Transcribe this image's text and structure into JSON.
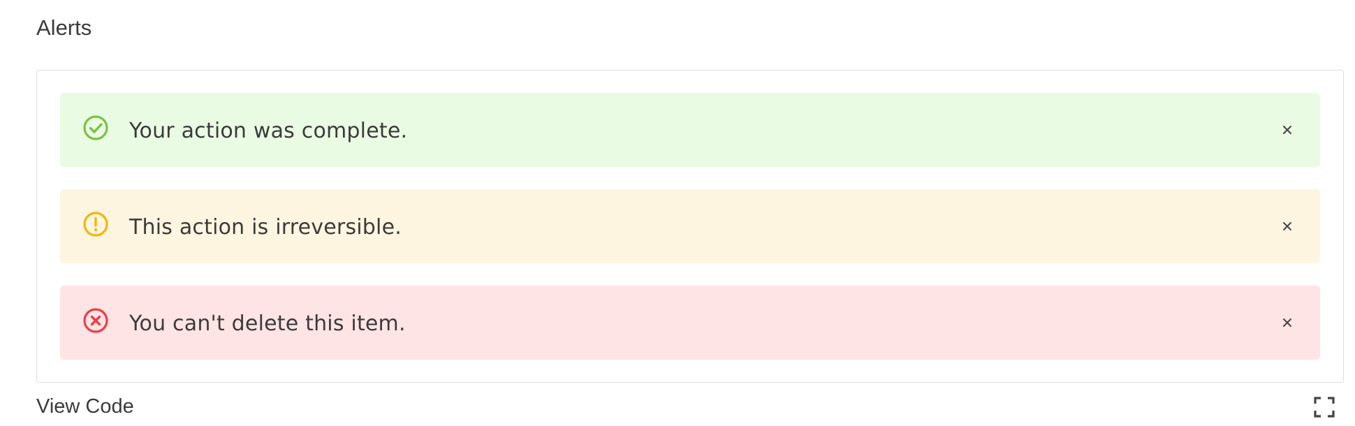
{
  "section": {
    "title": "Alerts"
  },
  "alerts": [
    {
      "type": "success",
      "message": "Your action was complete.",
      "icon": "check-circle-icon",
      "background": "#eafbe3",
      "icon_color": "#7cc143"
    },
    {
      "type": "warning",
      "message": "This action is irreversible.",
      "icon": "exclamation-circle-icon",
      "background": "#fdf5df",
      "icon_color": "#f5b50a"
    },
    {
      "type": "error",
      "message": "You can't delete this item.",
      "icon": "x-circle-icon",
      "background": "#fee4e5",
      "icon_color": "#ee3d48"
    }
  ],
  "footer": {
    "view_code_label": "View Code",
    "fullscreen_icon": "fullscreen-icon"
  }
}
